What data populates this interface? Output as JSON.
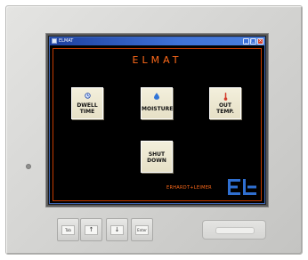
{
  "window": {
    "title": "ELMAT"
  },
  "app": {
    "title": "ELMAT",
    "buttons": {
      "dwell_time": {
        "line1": "DWELL",
        "line2": "TIME",
        "icon": "clock-icon"
      },
      "moisture": {
        "line1": "MOISTURE",
        "icon": "water-drop-icon"
      },
      "out_temp": {
        "line1": "OUT",
        "line2": "TEMP.",
        "icon": "thermometer-icon"
      },
      "shut_down": {
        "line1": "SHUT",
        "line2": "DOWN"
      }
    },
    "brand_text": "ERHARDT+LEIMER",
    "logo_letters": "EL"
  },
  "keypad": {
    "tab": "Tab",
    "up": "↑",
    "down": "↓",
    "enter": "Enter"
  },
  "colors": {
    "accent": "#ff6a1a",
    "logo_blue": "#2f6fd0",
    "titlebar": "#3f72d6"
  }
}
